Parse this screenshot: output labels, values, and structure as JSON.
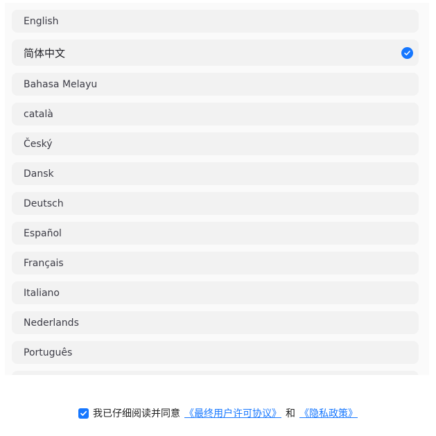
{
  "languages": [
    {
      "label": "English",
      "selected": false
    },
    {
      "label": "简体中文",
      "selected": true
    },
    {
      "label": "Bahasa Melayu",
      "selected": false
    },
    {
      "label": "català",
      "selected": false
    },
    {
      "label": "Český",
      "selected": false
    },
    {
      "label": "Dansk",
      "selected": false
    },
    {
      "label": "Deutsch",
      "selected": false
    },
    {
      "label": "Español",
      "selected": false
    },
    {
      "label": "Français",
      "selected": false
    },
    {
      "label": "Italiano",
      "selected": false
    },
    {
      "label": "Nederlands",
      "selected": false
    },
    {
      "label": "Português",
      "selected": false
    }
  ],
  "agreement": {
    "checked": true,
    "text": "我已仔细阅读并同意",
    "eula_link": "《最终用户许可协议》",
    "and_text": "和",
    "privacy_link": "《隐私政策》"
  },
  "colors": {
    "accent": "#1677ff",
    "item_bg": "#f2f2f2",
    "panel_bg": "#fafafa"
  },
  "icons": {
    "selected": "check-circle-icon",
    "checkbox": "checkbox-checked-icon"
  }
}
